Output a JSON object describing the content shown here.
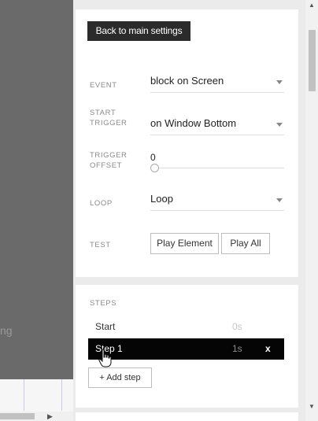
{
  "canvas": {
    "partial_text": "ng"
  },
  "settings": {
    "back_button": "Back to main settings",
    "event": {
      "label": "EVENT",
      "value": "block on Screen"
    },
    "start_trigger": {
      "label_line1": "START",
      "label_line2": "TRIGGER",
      "value": "on Window Bottom"
    },
    "trigger_offset": {
      "label_line1": "TRIGGER",
      "label_line2": "OFFSET",
      "value": "0"
    },
    "loop": {
      "label": "LOOP",
      "value": "Loop"
    },
    "test": {
      "label": "TEST",
      "play_element": "Play Element",
      "play_all": "Play All"
    }
  },
  "steps": {
    "title": "STEPS",
    "items": [
      {
        "name": "Start",
        "duration": "0s",
        "deletable": false,
        "active": false
      },
      {
        "name": "Step 1",
        "duration": "1s",
        "deletable": true,
        "active": true,
        "delete_label": "x"
      }
    ],
    "add_button": "+ Add step"
  },
  "colors": {
    "active_step_bg": "#050505",
    "back_button_bg": "#2b2b2b",
    "panel_bg": "#ebebeb",
    "canvas_overlay": "#6a6a6a"
  },
  "icons": [
    "caret-down-icon",
    "hand-cursor-icon",
    "scroll-arrow-icon"
  ]
}
